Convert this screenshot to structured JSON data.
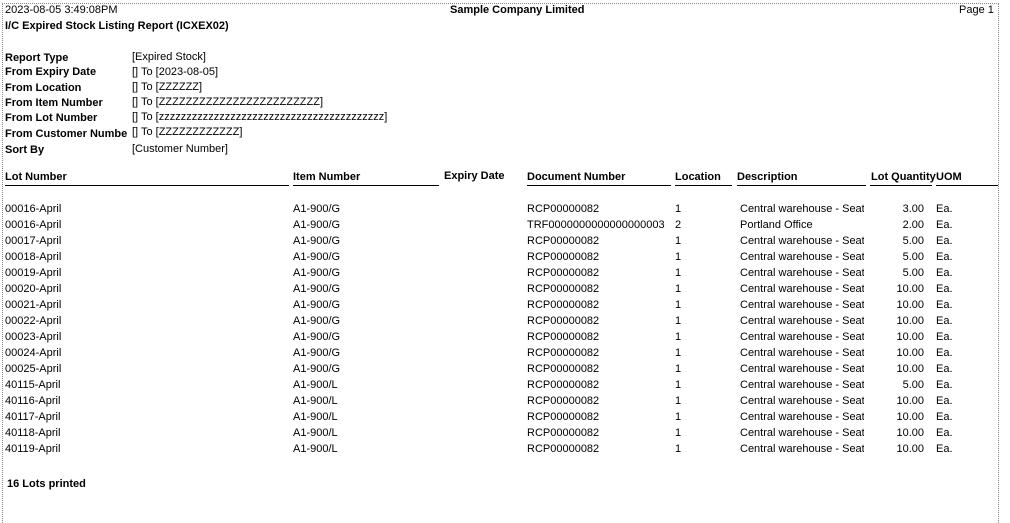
{
  "header": {
    "datetime": "2023-08-05  3:49:08PM",
    "company": "Sample Company Limited",
    "page": "Page 1",
    "title": "I/C Expired Stock Listing Report (ICXEX02)"
  },
  "criteria": [
    {
      "label": "Report Type",
      "value": "[Expired Stock]"
    },
    {
      "label": "From Expiry Date",
      "value": "[]  To  [2023-08-05]"
    },
    {
      "label": "From Location",
      "value": "[]  To  [ZZZZZZ]"
    },
    {
      "label": "From Item Number",
      "value": "[] To [ZZZZZZZZZZZZZZZZZZZZZZZZ]"
    },
    {
      "label": "From Lot Number",
      "value": "[] To [zzzzzzzzzzzzzzzzzzzzzzzzzzzzzzzzzzzzzzzzz]"
    },
    {
      "label": "From Customer Numbe",
      "value": "[] To [ZZZZZZZZZZZZ]"
    },
    {
      "label": "Sort By",
      "value": "[Customer Number]"
    }
  ],
  "columns": {
    "lot": "Lot Number",
    "item": "Item Number",
    "expiry": "Expiry Date",
    "doc": "Document Number",
    "loc": "Location",
    "desc": "Description",
    "qty": "Lot Quantity",
    "uom": "UOM"
  },
  "rows": [
    {
      "lot": "00016-April",
      "item": "A1-900/G",
      "doc": "RCP00000082",
      "loc": "1",
      "desc": "Central warehouse - Seatt",
      "qty": "3.00",
      "uom": "Ea."
    },
    {
      "lot": "00016-April",
      "item": "A1-900/G",
      "doc": "TRF0000000000000000003",
      "loc": "2",
      "desc": "Portland Office",
      "qty": "2.00",
      "uom": "Ea."
    },
    {
      "lot": "00017-April",
      "item": "A1-900/G",
      "doc": "RCP00000082",
      "loc": "1",
      "desc": "Central warehouse - Seatt",
      "qty": "5.00",
      "uom": "Ea."
    },
    {
      "lot": "00018-April",
      "item": "A1-900/G",
      "doc": "RCP00000082",
      "loc": "1",
      "desc": "Central warehouse - Seatt",
      "qty": "5.00",
      "uom": "Ea."
    },
    {
      "lot": "00019-April",
      "item": "A1-900/G",
      "doc": "RCP00000082",
      "loc": "1",
      "desc": "Central warehouse - Seatt",
      "qty": "5.00",
      "uom": "Ea."
    },
    {
      "lot": "00020-April",
      "item": "A1-900/G",
      "doc": "RCP00000082",
      "loc": "1",
      "desc": "Central warehouse - Seatt",
      "qty": "10.00",
      "uom": "Ea."
    },
    {
      "lot": "00021-April",
      "item": "A1-900/G",
      "doc": "RCP00000082",
      "loc": "1",
      "desc": "Central warehouse - Seatt",
      "qty": "10.00",
      "uom": "Ea."
    },
    {
      "lot": "00022-April",
      "item": "A1-900/G",
      "doc": "RCP00000082",
      "loc": "1",
      "desc": "Central warehouse - Seatt",
      "qty": "10.00",
      "uom": "Ea."
    },
    {
      "lot": "00023-April",
      "item": "A1-900/G",
      "doc": "RCP00000082",
      "loc": "1",
      "desc": "Central warehouse - Seatt",
      "qty": "10.00",
      "uom": "Ea."
    },
    {
      "lot": "00024-April",
      "item": "A1-900/G",
      "doc": "RCP00000082",
      "loc": "1",
      "desc": "Central warehouse - Seatt",
      "qty": "10.00",
      "uom": "Ea."
    },
    {
      "lot": "00025-April",
      "item": "A1-900/G",
      "doc": "RCP00000082",
      "loc": "1",
      "desc": "Central warehouse - Seatt",
      "qty": "10.00",
      "uom": "Ea."
    },
    {
      "lot": "40115-April",
      "item": "A1-900/L",
      "doc": "RCP00000082",
      "loc": "1",
      "desc": "Central warehouse - Seatt",
      "qty": "5.00",
      "uom": "Ea."
    },
    {
      "lot": "40116-April",
      "item": "A1-900/L",
      "doc": "RCP00000082",
      "loc": "1",
      "desc": "Central warehouse - Seatt",
      "qty": "10.00",
      "uom": "Ea."
    },
    {
      "lot": "40117-April",
      "item": "A1-900/L",
      "doc": "RCP00000082",
      "loc": "1",
      "desc": "Central warehouse - Seatt",
      "qty": "10.00",
      "uom": "Ea."
    },
    {
      "lot": "40118-April",
      "item": "A1-900/L",
      "doc": "RCP00000082",
      "loc": "1",
      "desc": "Central warehouse - Seatt",
      "qty": "10.00",
      "uom": "Ea."
    },
    {
      "lot": "40119-April",
      "item": "A1-900/L",
      "doc": "RCP00000082",
      "loc": "1",
      "desc": "Central warehouse - Seatt",
      "qty": "10.00",
      "uom": "Ea."
    }
  ],
  "footer": {
    "summary": "16 Lots printed"
  }
}
